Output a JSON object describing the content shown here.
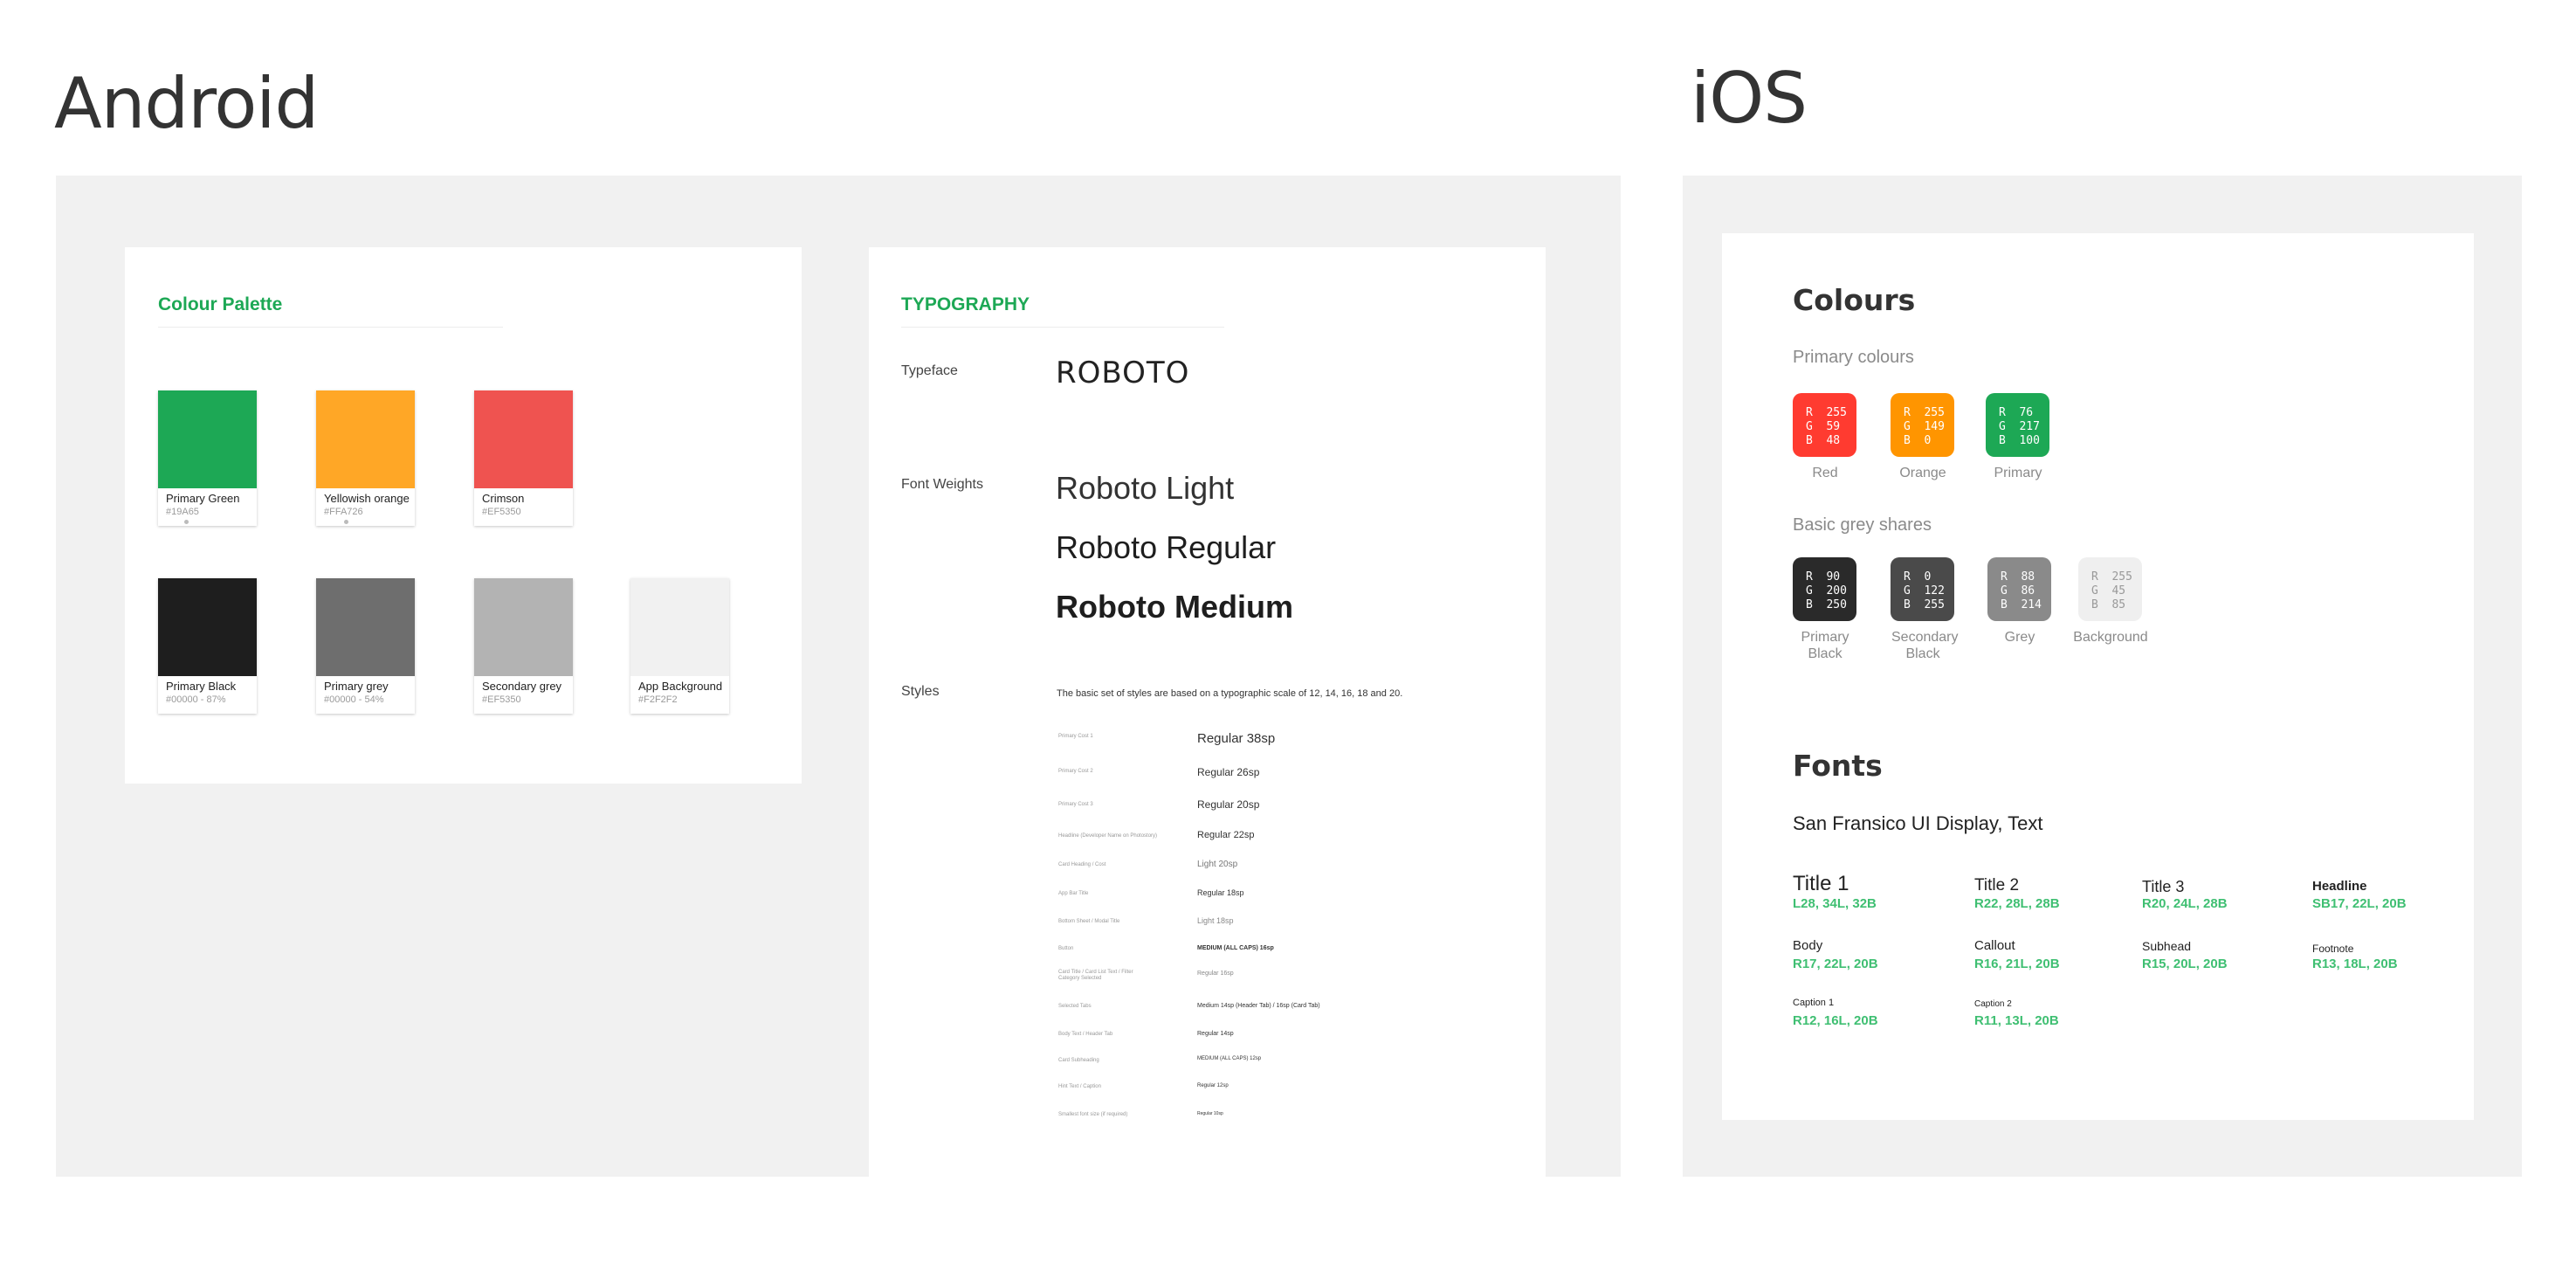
{
  "android": {
    "title": "Android",
    "palette": {
      "title": "Colour Palette",
      "swatches": [
        {
          "name": "Primary Green",
          "hex": "#19A65",
          "color": "#1da855"
        },
        {
          "name": "Yellowish orange",
          "hex": "#FFA726",
          "color": "#ffa726"
        },
        {
          "name": "Crimson",
          "hex": "#EF5350",
          "color": "#ef5350"
        },
        {
          "name": "Primary Black",
          "hex": "#00000 - 87%",
          "color": "#1e1e1e"
        },
        {
          "name": "Primary grey",
          "hex": "#00000 - 54%",
          "color": "#6e6e6e"
        },
        {
          "name": "Secondary grey",
          "hex": "#EF5350",
          "color": "#b3b3b3"
        },
        {
          "name": "App Background",
          "hex": "#F2F2F2",
          "color": "#f1f1f1"
        }
      ]
    },
    "typography": {
      "title": "TYPOGRAPHY",
      "typeface_label": "Typeface",
      "typeface_value": "ROBOTO",
      "weights_label": "Font Weights",
      "weights": [
        "Roboto Light",
        "Roboto Regular",
        "Roboto Medium"
      ],
      "styles_label": "Styles",
      "styles_intro": "The basic set of styles are based on a typographic scale of 12, 14, 16, 18 and 20.",
      "styles": [
        {
          "name": "Primary Cost 1",
          "spec": "Regular 38sp"
        },
        {
          "name": "Primary Cost 2",
          "spec": "Regular 26sp"
        },
        {
          "name": "Primary Cost 3",
          "spec": "Regular 20sp"
        },
        {
          "name": "Headline (Developer Name on Photostory)",
          "spec": "Regular 22sp"
        },
        {
          "name": "Card Heading / Cost",
          "spec": "Light 20sp"
        },
        {
          "name": "App Bar Title",
          "spec": "Regular 18sp"
        },
        {
          "name": "Bottom Sheet / Modal Title",
          "spec": "Light 18sp"
        },
        {
          "name": "Button",
          "spec": "MEDIUM (ALL CAPS) 16sp"
        },
        {
          "name": "Card Title / Card List Text / Filter Category Selected",
          "spec": "Regular 16sp"
        },
        {
          "name": "Selected Tabs",
          "spec": "Medium 14sp (Header Tab) / 16sp (Card Tab)"
        },
        {
          "name": "Body Text / Header Tab",
          "spec": "Regular 14sp"
        },
        {
          "name": "Card Subheading",
          "spec": "MEDIUM (ALL CAPS) 12sp"
        },
        {
          "name": "Hint Text / Caption",
          "spec": "Regular 12sp"
        },
        {
          "name": "Smallest font size (if required)",
          "spec": "Regular 10sp"
        }
      ]
    }
  },
  "ios": {
    "title": "iOS",
    "colours_title": "Colours",
    "primary_label": "Primary colours",
    "primary_swatches": [
      {
        "r": "255",
        "g": "59",
        "b": "48",
        "label": "Red",
        "color": "#ff3b30"
      },
      {
        "r": "255",
        "g": "149",
        "b": "0",
        "label": "Orange",
        "color": "#ff9500"
      },
      {
        "r": "76",
        "g": "217",
        "b": "100",
        "label": "Primary",
        "color": "#1da855"
      }
    ],
    "grey_label": "Basic grey shares",
    "grey_swatches": [
      {
        "r": "90",
        "g": "200",
        "b": "250",
        "label": "Primary Black",
        "color": "#2a2a2a"
      },
      {
        "r": "0",
        "g": "122",
        "b": "255",
        "label": "Secondary Black",
        "color": "#4a4a4a"
      },
      {
        "r": "88",
        "g": "86",
        "b": "214",
        "label": "Grey",
        "color": "#8a8a8a"
      },
      {
        "r": "255",
        "g": "45",
        "b": "85",
        "label": "Background",
        "color": "#efefef"
      }
    ],
    "fonts_title": "Fonts",
    "font_family": "San Fransico UI Display, Text",
    "fonts": [
      {
        "name": "Title 1",
        "spec": "L28, 34L, 32B"
      },
      {
        "name": "Title 2",
        "spec": "R22, 28L, 28B"
      },
      {
        "name": "Title 3",
        "spec": "R20, 24L, 28B"
      },
      {
        "name": "Headline",
        "spec": "SB17, 22L, 20B"
      },
      {
        "name": "Body",
        "spec": "R17, 22L,  20B"
      },
      {
        "name": "Callout",
        "spec": "R16, 21L,  20B"
      },
      {
        "name": "Subhead",
        "spec": "R15, 20L, 20B"
      },
      {
        "name": "Footnote",
        "spec": "R13, 18L, 20B"
      },
      {
        "name": "Caption 1",
        "spec": "R12, 16L, 20B"
      },
      {
        "name": "Caption 2",
        "spec": "R11, 13L, 20B"
      }
    ]
  }
}
